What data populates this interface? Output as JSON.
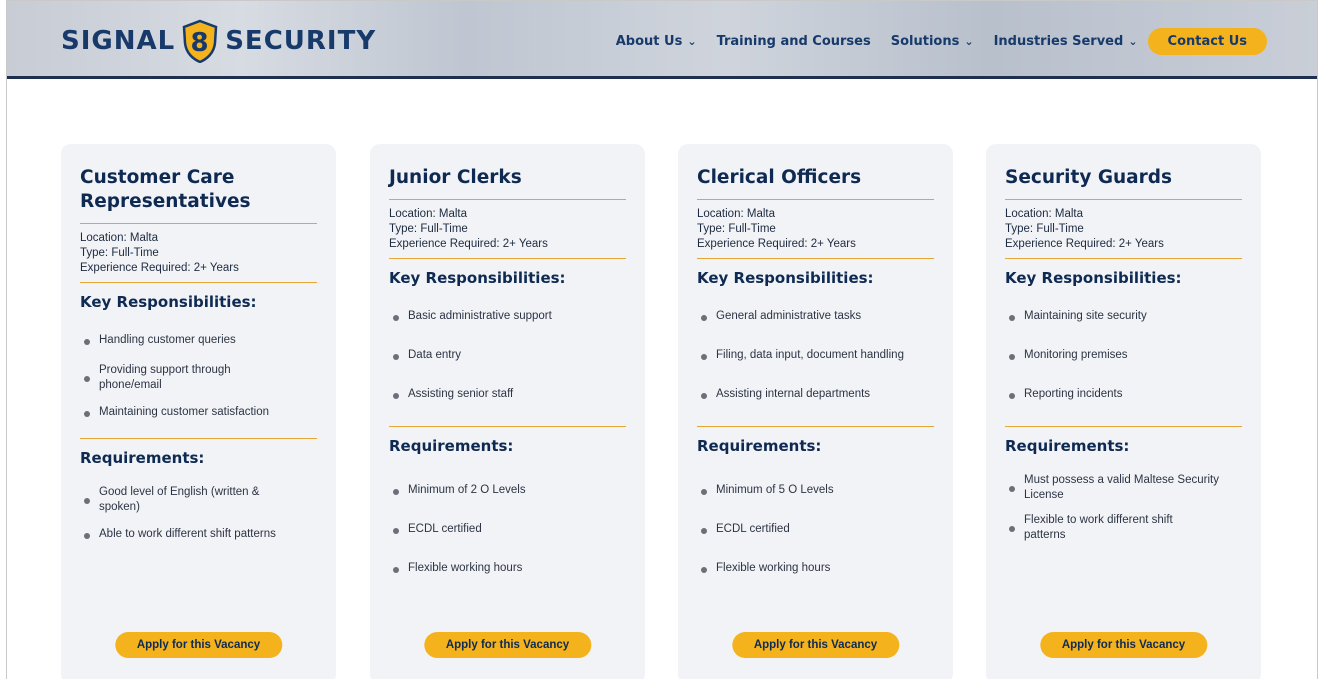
{
  "brand": {
    "left": "SIGNAL",
    "digit": "8",
    "right": "SECURITY"
  },
  "nav": {
    "about": "About Us",
    "training": "Training and Courses",
    "solutions": "Solutions",
    "industries": "Industries Served",
    "contact": "Contact Us"
  },
  "colors": {
    "accent": "#f4b21c",
    "navy": "#0f2a52",
    "card_bg": "#f2f3f6"
  },
  "cards": [
    {
      "title_line1": "Customer Care",
      "title_line2": "Representatives",
      "location": "Location: Malta",
      "type": "Type: Full-Time",
      "experience": "Experience Required: 2+ Years",
      "resp_title": "Key Responsibilities:",
      "responsibilities": [
        "Handling customer queries",
        "Providing support through phone/email",
        "Maintaining customer satisfaction"
      ],
      "req_title": "Requirements:",
      "requirements": [
        "Good level of English (written & spoken)",
        "Able to work different shift patterns"
      ],
      "apply": "Apply for this Vacancy"
    },
    {
      "title_line1": "Junior Clerks",
      "title_line2": "",
      "location": "Location: Malta",
      "type": "Type: Full-Time",
      "experience": "Experience Required: 2+ Years",
      "resp_title": "Key Responsibilities:",
      "responsibilities": [
        "Basic administrative support",
        "Data entry",
        "Assisting senior staff"
      ],
      "req_title": "Requirements:",
      "requirements": [
        "Minimum of 2 O Levels",
        "ECDL certified",
        "Flexible working hours"
      ],
      "apply": "Apply for this Vacancy"
    },
    {
      "title_line1": "Clerical Officers",
      "title_line2": "",
      "location": "Location: Malta",
      "type": "Type: Full-Time",
      "experience": "Experience Required: 2+ Years",
      "resp_title": "Key Responsibilities:",
      "responsibilities": [
        "General administrative tasks",
        "Filing, data input, document handling",
        "Assisting internal departments"
      ],
      "req_title": "Requirements:",
      "requirements": [
        "Minimum of 5 O Levels",
        "ECDL certified",
        "Flexible working hours"
      ],
      "apply": "Apply for this Vacancy"
    },
    {
      "title_line1": "Security Guards",
      "title_line2": "",
      "location": "Location: Malta",
      "type": "Type: Full-Time",
      "experience": "Experience Required: 2+ Years",
      "resp_title": "Key Responsibilities:",
      "responsibilities": [
        "Maintaining site security",
        "Monitoring premises",
        "Reporting incidents"
      ],
      "req_title": "Requirements:",
      "requirements": [
        "Must possess a valid Maltese Security License",
        "Flexible to work different shift patterns"
      ],
      "apply": "Apply for this Vacancy"
    }
  ]
}
